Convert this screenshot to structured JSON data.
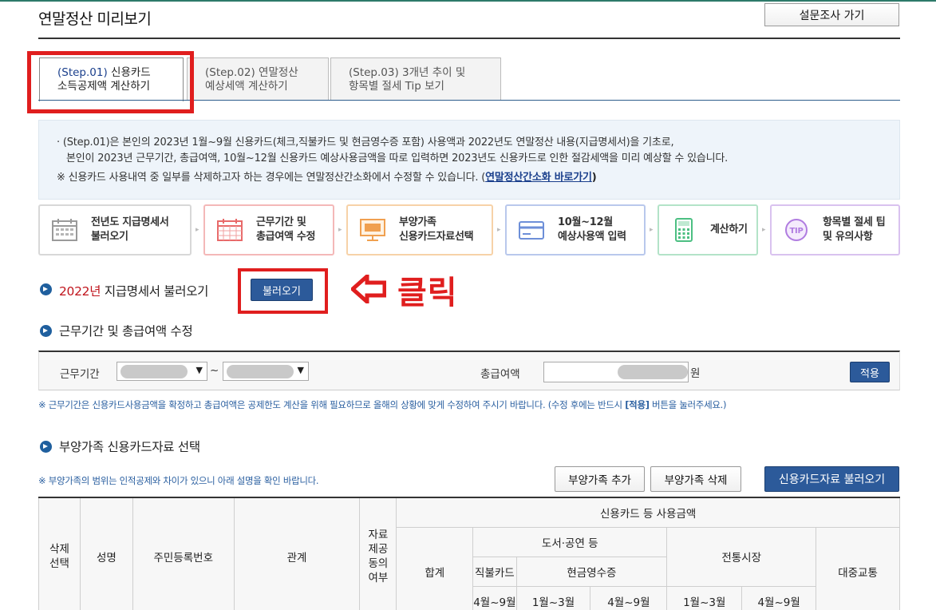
{
  "header": {
    "title": "연말정산 미리보기",
    "survey_button": "설문조사 가기"
  },
  "tabs": [
    {
      "step": "(Step.01)",
      "label_a": "신용카드",
      "label_b": "소득공제액 계산하기",
      "active": true
    },
    {
      "step": "(Step.02)",
      "label_a": "연말정산",
      "label_b": "예상세액 계산하기",
      "active": false
    },
    {
      "step": "(Step.03)",
      "label_a": "3개년 추이 및",
      "label_b": "항목별 절세 Tip 보기",
      "active": false
    }
  ],
  "info": {
    "line1": "· (Step.01)은 본인의 2023년 1월~9월 신용카드(체크,직불카드 및 현금영수증 포함) 사용액과 2022년도 연말정산 내용(지급명세서)을 기초로,",
    "line2": "본인이 2023년 근무기간, 총급여액, 10월~12월 신용카드 예상사용금액을 따로 입력하면 2023년도 신용카드로 인한 절감세액을 미리 예상할 수 있습니다.",
    "line3_prefix": "※ 신용카드 사용내역 중 일부를 삭제하고자 하는 경우에는 연말정산간소화에서 수정할 수 있습니다. (",
    "line3_link": "연말정산간소화 바로가기",
    "line3_suffix": ")"
  },
  "process_steps": [
    {
      "line1": "전년도 지급명세서",
      "line2": "불러오기",
      "icon": "calendar-icon",
      "color": "#9a9a9a"
    },
    {
      "line1": "근무기간 및",
      "line2": "총급여액 수정",
      "icon": "calendar-grid-icon",
      "color": "#e86a6a"
    },
    {
      "line1": "부양가족",
      "line2": "신용카드자료선택",
      "icon": "monitor-icon",
      "color": "#f0a050"
    },
    {
      "line1": "10월~12월",
      "line2": "예상사용액 입력",
      "icon": "credit-card-icon",
      "color": "#6d8fd8"
    },
    {
      "line1": "계산하기",
      "line2": "",
      "icon": "calculator-icon",
      "color": "#4cbf82"
    },
    {
      "line1": "항목별 절세 팁",
      "line2": "및 유의사항",
      "icon": "tip-icon",
      "color": "#b07ce0"
    }
  ],
  "section1": {
    "year": "2022년",
    "title": "지급명세서 불러오기",
    "button": "불러오기",
    "annotation": "클릭"
  },
  "section2": {
    "title": "근무기간 및 총급여액 수정",
    "period_label": "근무기간",
    "tilde": "~",
    "salary_label": "총급여액",
    "unit": "원",
    "apply_button": "적용",
    "note_prefix": "※ 근무기간은 신용카드사용금액을 확정하고 총급여액은 공제한도 계산을 위해 필요하므로 올해의 상황에 맞게 수정하여 주시기 바랍니다. (수정 후에는 반드시 ",
    "note_em": "[적용]",
    "note_suffix": " 버튼을 눌러주세요.)"
  },
  "section3": {
    "title": "부양가족 신용카드자료 선택",
    "note": "※ 부양가족의 범위는 인적공제와 차이가 있으니 아래 설명을 확인 바랍니다.",
    "add_button": "부양가족 추가",
    "delete_button": "부양가족 삭제",
    "load_button": "신용카드자료 불러오기"
  },
  "table": {
    "col_delete": "삭제선택",
    "col_delete_a": "삭제",
    "col_delete_b": "선택",
    "col_name": "성명",
    "col_rrn": "주민등록번호",
    "col_relation": "관계",
    "col_consent_lines": [
      "자료",
      "제공",
      "동의",
      "여부"
    ],
    "group_usage": "신용카드 등 사용금액",
    "col_total": "합계",
    "group_books": "도서·공연 등",
    "group_market": "전통시장",
    "col_transit": "대중교통",
    "sub_debit": "직불카드",
    "sub_cash": "현금영수증",
    "p_apr_sep": "4월~9월",
    "p_jan_mar": "1월~3월"
  }
}
